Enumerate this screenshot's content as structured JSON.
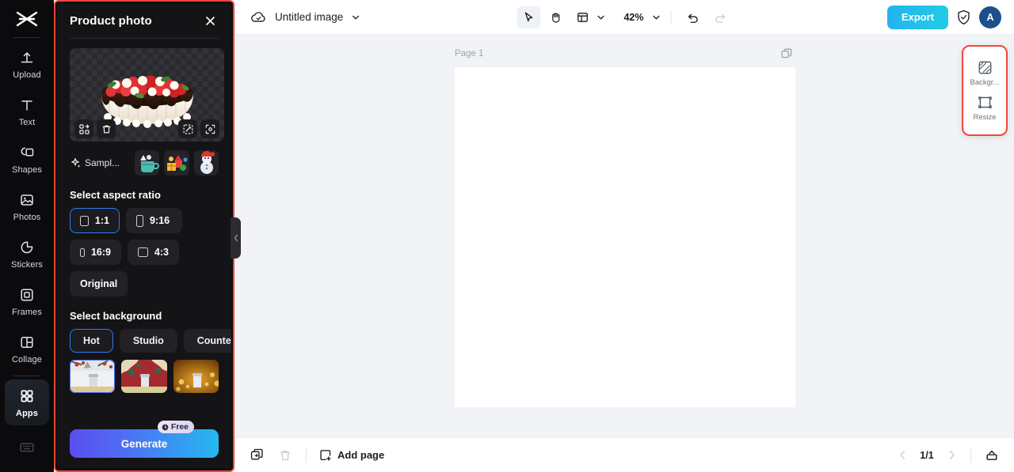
{
  "rail": {
    "logo_icon": "capcut-logo-icon",
    "items": [
      {
        "label": "Upload",
        "icon": "upload-icon"
      },
      {
        "label": "Text",
        "icon": "text-icon"
      },
      {
        "label": "Shapes",
        "icon": "shapes-icon"
      },
      {
        "label": "Photos",
        "icon": "photos-icon"
      },
      {
        "label": "Stickers",
        "icon": "stickers-icon"
      },
      {
        "label": "Frames",
        "icon": "frames-icon"
      },
      {
        "label": "Collage",
        "icon": "collage-icon"
      },
      {
        "label": "Apps",
        "icon": "apps-grid-icon"
      }
    ],
    "active_item": "Apps",
    "bottom_icon": "keyboard-icon"
  },
  "panel": {
    "title": "Product photo",
    "close_icon": "close-icon",
    "highlight_color": "#f5443a",
    "preview": {
      "image_alt": "strawberry-chocolate-cake",
      "tools": [
        {
          "name": "replace-image-icon",
          "glyph": "replace"
        },
        {
          "name": "delete-icon",
          "glyph": "trash"
        },
        {
          "name": "magic-edit-icon",
          "glyph": "wand"
        },
        {
          "name": "fit-frame-icon",
          "glyph": "expand"
        }
      ]
    },
    "samples": {
      "icon": "sparkle-icon",
      "label": "Sampl...",
      "thumbs": [
        "sample-mug-thumb",
        "sample-gifts-thumb",
        "sample-snowman-thumb"
      ]
    },
    "aspect_ratio": {
      "title": "Select aspect ratio",
      "selected": "1:1",
      "options": [
        {
          "label": "1:1",
          "w": 13,
          "h": 13
        },
        {
          "label": "9:16",
          "w": 9,
          "h": 15
        },
        {
          "label": "16:9",
          "w": 17,
          "h": 11
        },
        {
          "label": "4:3",
          "w": 15,
          "h": 12
        },
        {
          "label": "Original",
          "w": 0,
          "h": 0
        }
      ]
    },
    "background": {
      "title": "Select background",
      "selected_tab": "Hot",
      "tabs": [
        "Hot",
        "Studio",
        "Countertop"
      ],
      "thumbs": [
        {
          "name": "bg-snow-berries-thumb",
          "selected": true
        },
        {
          "name": "bg-red-festive-thumb",
          "selected": false
        },
        {
          "name": "bg-golden-bokeh-thumb",
          "selected": false
        }
      ]
    },
    "generate": {
      "label": "Generate",
      "badge": "Free",
      "badge_icon": "clock-icon"
    },
    "collapse_icon": "chevron-left-icon"
  },
  "topbar": {
    "cloud_icon": "cloud-saved-icon",
    "doc_name": "Untitled image",
    "doc_caret_icon": "chevron-down-icon",
    "tools": [
      {
        "name": "select-tool",
        "icon": "cursor-arrow-icon",
        "active": true
      },
      {
        "name": "hand-tool",
        "icon": "hand-icon",
        "active": false
      },
      {
        "name": "layout-tool",
        "icon": "layout-icon",
        "active": false
      }
    ],
    "layout_caret_icon": "chevron-down-icon",
    "zoom": "42%",
    "zoom_caret_icon": "chevron-down-icon",
    "undo_icon": "undo-icon",
    "redo_icon": "redo-icon",
    "export_label": "Export",
    "export_color": "#22bdec",
    "shield_icon": "shield-check-icon",
    "avatar_initial": "A",
    "avatar_color": "#1d4f8a"
  },
  "canvas": {
    "page_label": "Page 1",
    "duplicate_page_icon": "duplicate-page-icon",
    "background_color": "#f1f3f6",
    "sheet_color": "#ffffff"
  },
  "float_panel": {
    "highlight_color": "#f5443a",
    "items": [
      {
        "label": "Backgr...",
        "icon": "background-swatch-icon"
      },
      {
        "label": "Resize",
        "icon": "resize-icon"
      }
    ]
  },
  "bottombar": {
    "duplicate_icon": "duplicate-icon",
    "delete_icon": "trash-icon",
    "add_page_icon": "add-page-icon",
    "add_page_label": "Add page",
    "prev_icon": "chevron-left-icon",
    "page_indicator": "1/1",
    "next_icon": "chevron-right-icon",
    "grid_view_icon": "page-tray-icon"
  }
}
